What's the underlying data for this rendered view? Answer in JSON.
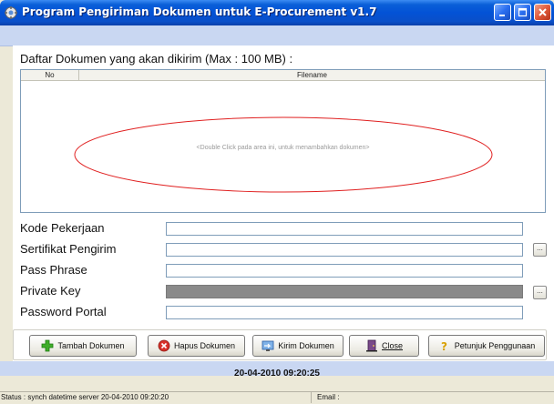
{
  "window": {
    "title": "Program Pengiriman Dokumen untuk E-Procurement v1.7",
    "icon": "app-icon",
    "controls": [
      "minimize-icon",
      "maximize-icon",
      "close-icon"
    ]
  },
  "document_list": {
    "title": "Daftar Dokumen yang akan dikirim (Max : 100 MB) :",
    "columns": [
      "No",
      "Filename"
    ],
    "hint": "<Double Click pada area ini, untuk menambahkan dokumen>",
    "highlight_color": "#e02020"
  },
  "fields": [
    {
      "label": "Kode Pekerjaan",
      "value": "",
      "placeholder": ""
    },
    {
      "label": "Sertifikat Pengirim",
      "value": "",
      "placeholder": "",
      "browse": "..."
    },
    {
      "label": "Pass Phrase",
      "value": "",
      "placeholder": ""
    },
    {
      "label": "Private Key",
      "value": "",
      "placeholder": "",
      "browse": "...",
      "disabled": true
    },
    {
      "label": "Password Portal",
      "value": "",
      "placeholder": ""
    }
  ],
  "buttons": [
    {
      "label": "Tambah Dokumen",
      "icon": "add-icon"
    },
    {
      "label": "Hapus Dokumen",
      "icon": "delete-icon"
    },
    {
      "label": "Kirim Dokumen",
      "icon": "send-icon"
    },
    {
      "label": "Close",
      "icon": "close-door-icon"
    },
    {
      "label": "Petunjuk Penggunaan",
      "icon": "help-icon"
    }
  ],
  "clock": "20-04-2010 09:20:25",
  "status": {
    "left": "Status : synch datetime server 20-04-2010 09:20:20",
    "right": "Email :"
  },
  "colors": {
    "titlebar": "#0352d6",
    "accent_band": "#c9d7f2",
    "ellipse": "#e02020"
  }
}
